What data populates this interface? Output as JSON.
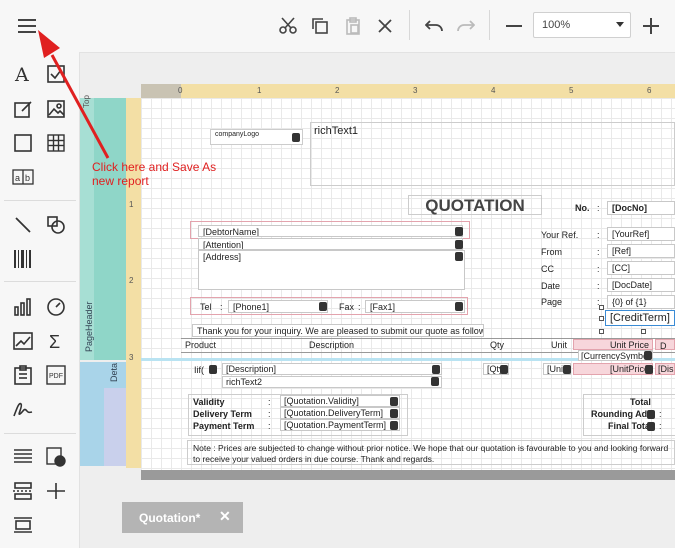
{
  "toolbar": {
    "zoom": "100%",
    "icons": [
      "menu-icon",
      "cut-icon",
      "copy-icon",
      "paste-icon",
      "delete-icon",
      "undo-icon",
      "redo-icon",
      "zoom-out-icon",
      "zoom-in-icon"
    ]
  },
  "annotation": {
    "line1": "Click here and Save As",
    "line2": "new report"
  },
  "bands": {
    "page_header": "PageHeader",
    "top_label": "Top",
    "detail": "Deta"
  },
  "ruler": {
    "top": [
      "0",
      "1",
      "2",
      "3",
      "4",
      "5",
      "6"
    ],
    "left": [
      "1",
      "2",
      "3"
    ]
  },
  "report": {
    "company_logo": "companyLogo",
    "rich_text1": "richText1",
    "title": "QUOTATION",
    "no_label": "No.",
    "doc_no": "[DocNo]",
    "debtor_name": "[DebtorName]",
    "attention": "[Attention]",
    "address": "[Address]",
    "tel_label": "Tel",
    "phone": "[Phone1]",
    "fax_label": "Fax",
    "fax": "[Fax1]",
    "your_ref_label": "Your Ref.",
    "your_ref": "[YourRef]",
    "from_label": "From",
    "ref": "[Ref]",
    "cc_label": "CC",
    "cc": "[CC]",
    "date_label": "Date",
    "doc_date": "[DocDate]",
    "page_label": "Page",
    "page_of": "{0} of {1}",
    "credit_term": "[CreditTerm]",
    "thank_you": "Thank you for your inquiry. We are pleased to submit our quote as follows:",
    "col_product": "Product",
    "col_description": "Description",
    "col_qty": "Qty",
    "col_unit": "Unit",
    "col_unit_price": "Unit Price",
    "col_d": "D",
    "currency_symbol": "[CurrencySymbo",
    "detail_if": "Iif(",
    "detail_description": "[Description]",
    "detail_qty": "[Qty",
    "detail_unit": "[Uni",
    "detail_unit_price": "[UnitPrice",
    "detail_dis": "[Dis",
    "rich_text2": "richText2",
    "validity_label": "Validity",
    "validity": "[Quotation.Validity]",
    "delivery_label": "Delivery Term",
    "delivery": "[Quotation.DeliveryTerm]",
    "payment_label": "Payment Term",
    "payment": "[Quotation.PaymentTerm]",
    "total_label": "Total",
    "rounding_label": "Rounding Ad",
    "final_total_label": "Final Tota",
    "note_line1": "Note : Prices are subjected to change without prior notice. We hope that our quotation is favourable to you and looking forward",
    "note_line2": "to receive your valued orders in due course. Thank and regards."
  },
  "tab": {
    "label": "Quotation*"
  },
  "colors": {
    "accent_red": "#e02020",
    "ruler": "#f3dfa5",
    "band_header": "#8fd6c8",
    "band_detail": "#a9d4e9",
    "pink_field": "#f7d6db"
  }
}
